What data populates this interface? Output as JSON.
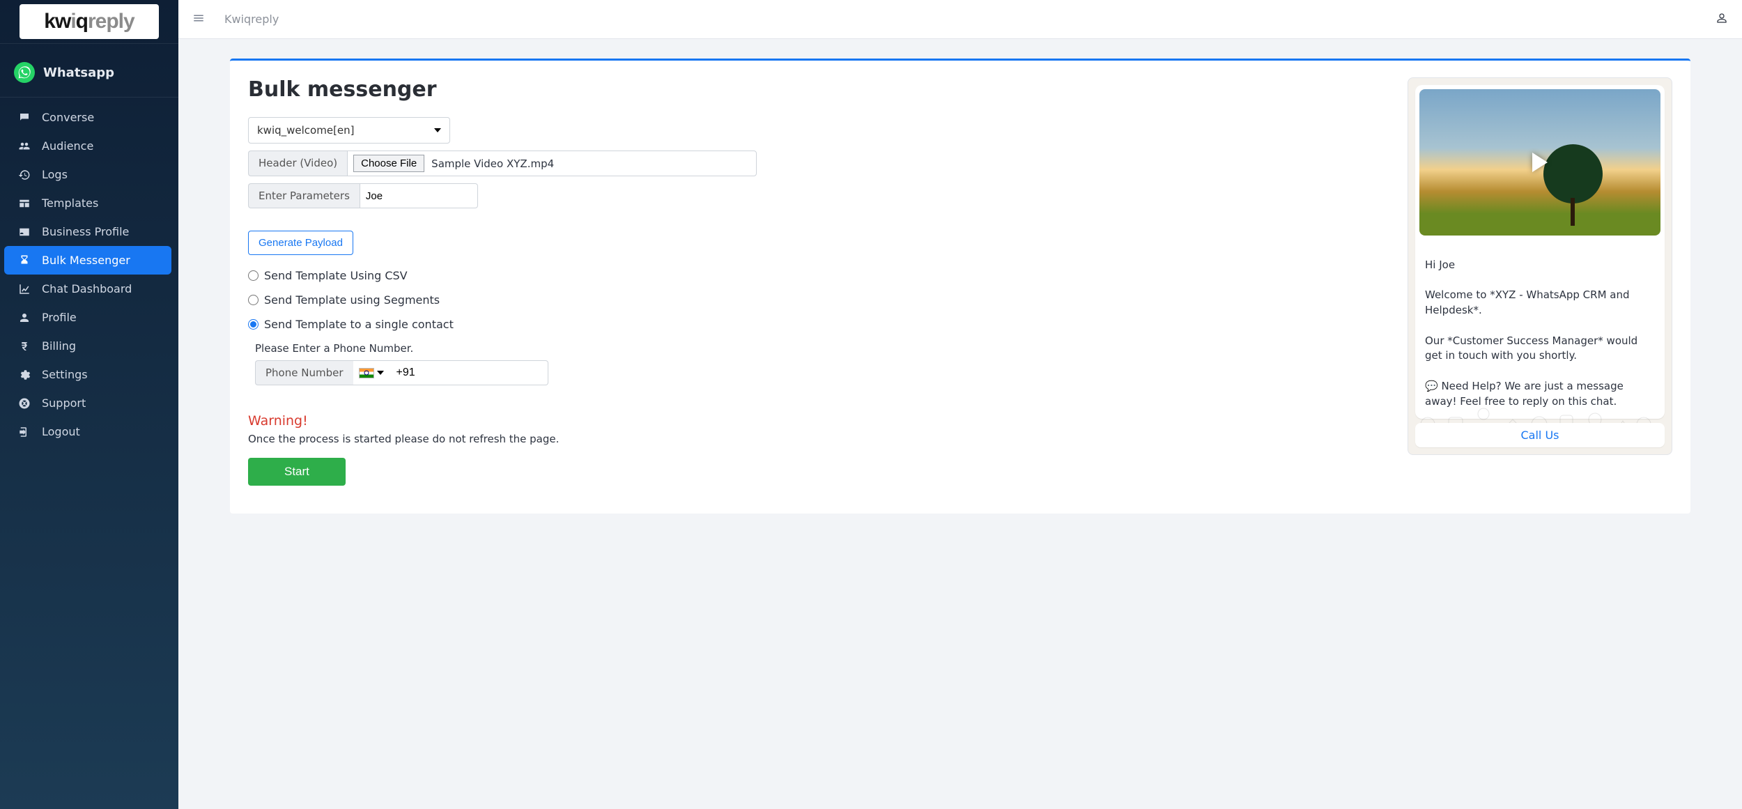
{
  "brand": "Kwiqreply",
  "sidebar": {
    "logo_text": "kwiqreply",
    "section_label": "Whatsapp",
    "items": [
      {
        "label": "Converse",
        "icon": "chat-icon"
      },
      {
        "label": "Audience",
        "icon": "people-icon"
      },
      {
        "label": "Logs",
        "icon": "history-icon"
      },
      {
        "label": "Templates",
        "icon": "templates-icon"
      },
      {
        "label": "Business Profile",
        "icon": "id-card-icon"
      },
      {
        "label": "Bulk Messenger",
        "icon": "hourglass-icon",
        "active": true
      },
      {
        "label": "Chat Dashboard",
        "icon": "chart-icon"
      },
      {
        "label": "Profile",
        "icon": "user-icon"
      },
      {
        "label": "Billing",
        "icon": "rupee-icon"
      },
      {
        "label": "Settings",
        "icon": "gears-icon"
      },
      {
        "label": "Support",
        "icon": "life-ring-icon"
      },
      {
        "label": "Logout",
        "icon": "logout-icon"
      }
    ]
  },
  "page": {
    "title": "Bulk messenger",
    "template_selected": "kwiq_welcome[en]",
    "header_label": "Header (Video)",
    "choose_file_label": "Choose File",
    "file_name": "Sample Video XYZ.mp4",
    "params_label": "Enter Parameters",
    "params_value": "Joe",
    "generate_btn": "Generate Payload",
    "send_options": {
      "csv": "Send Template Using CSV",
      "segments": "Send Template using Segments",
      "single": "Send Template to a single contact"
    },
    "phone": {
      "hint": "Please Enter a Phone Number.",
      "label": "Phone Number",
      "dial_code": "+91"
    },
    "warning_title": "Warning!",
    "warning_body": "Once the process is started please do not refresh the page.",
    "start_btn": "Start"
  },
  "preview": {
    "greeting": "Hi Joe",
    "body": "Welcome to *XYZ - WhatsApp CRM and Helpdesk*.\n\nOur *Customer Success Manager* would get in touch with you shortly.\n\n💬 Need Help? We are just a message away! Feel free to reply on this chat.",
    "cta": "Call Us"
  }
}
